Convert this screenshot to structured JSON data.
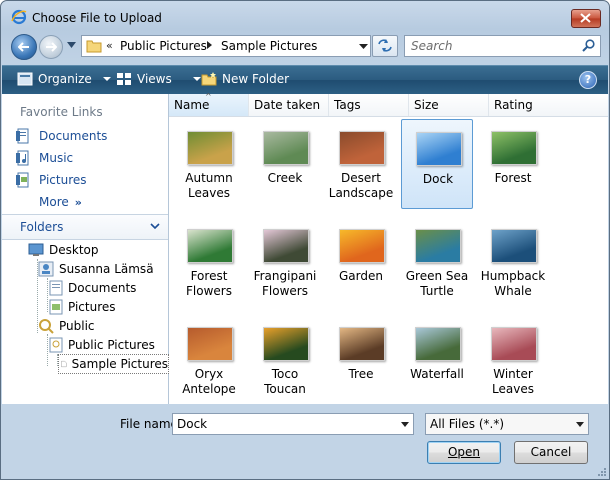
{
  "window": {
    "title": "Choose File to Upload",
    "icon": "ie-icon"
  },
  "address": {
    "overflow": "«",
    "crumbs": [
      "Public Pictures",
      "Sample Pictures"
    ],
    "search_placeholder": "Search"
  },
  "toolbar": {
    "organize": "Organize",
    "views": "Views",
    "new_folder": "New Folder",
    "help": "?"
  },
  "favorites": {
    "heading": "Favorite Links",
    "items": [
      "Documents",
      "Music",
      "Pictures"
    ],
    "more": "More",
    "more_arrows": "»"
  },
  "folders": {
    "heading": "Folders",
    "tree": [
      "Desktop",
      "Susanna Lämsä",
      "Documents",
      "Pictures",
      "Public",
      "Public Pictures",
      "Sample Pictures"
    ],
    "selected": "Sample Pictures"
  },
  "columns": [
    "Name",
    "Date taken",
    "Tags",
    "Size",
    "Rating"
  ],
  "files": [
    {
      "name": "Autumn\nLeaves",
      "l1": "Autumn",
      "l2": "Leaves"
    },
    {
      "name": "Creek",
      "l1": "Creek",
      "l2": ""
    },
    {
      "name": "Desert Landscape",
      "l1": "Desert",
      "l2": "Landscape"
    },
    {
      "name": "Dock",
      "l1": "Dock",
      "l2": ""
    },
    {
      "name": "Forest",
      "l1": "Forest",
      "l2": ""
    },
    {
      "name": "Forest Flowers",
      "l1": "Forest",
      "l2": "Flowers"
    },
    {
      "name": "Frangipani Flowers",
      "l1": "Frangipani",
      "l2": "Flowers"
    },
    {
      "name": "Garden",
      "l1": "Garden",
      "l2": ""
    },
    {
      "name": "Green Sea Turtle",
      "l1": "Green Sea",
      "l2": "Turtle"
    },
    {
      "name": "Humpback Whale",
      "l1": "Humpback",
      "l2": "Whale"
    },
    {
      "name": "Oryx Antelope",
      "l1": "Oryx",
      "l2": "Antelope"
    },
    {
      "name": "Toco Toucan",
      "l1": "Toco Toucan",
      "l2": ""
    },
    {
      "name": "Tree",
      "l1": "Tree",
      "l2": ""
    },
    {
      "name": "Waterfall",
      "l1": "Waterfall",
      "l2": ""
    },
    {
      "name": "Winter Leaves",
      "l1": "Winter",
      "l2": "Leaves"
    }
  ],
  "selected_file": "Dock",
  "bottom": {
    "file_name_label": "File name:",
    "file_name_value": "Dock",
    "file_type": "All Files (*.*)",
    "open": "Open",
    "cancel": "Cancel"
  }
}
